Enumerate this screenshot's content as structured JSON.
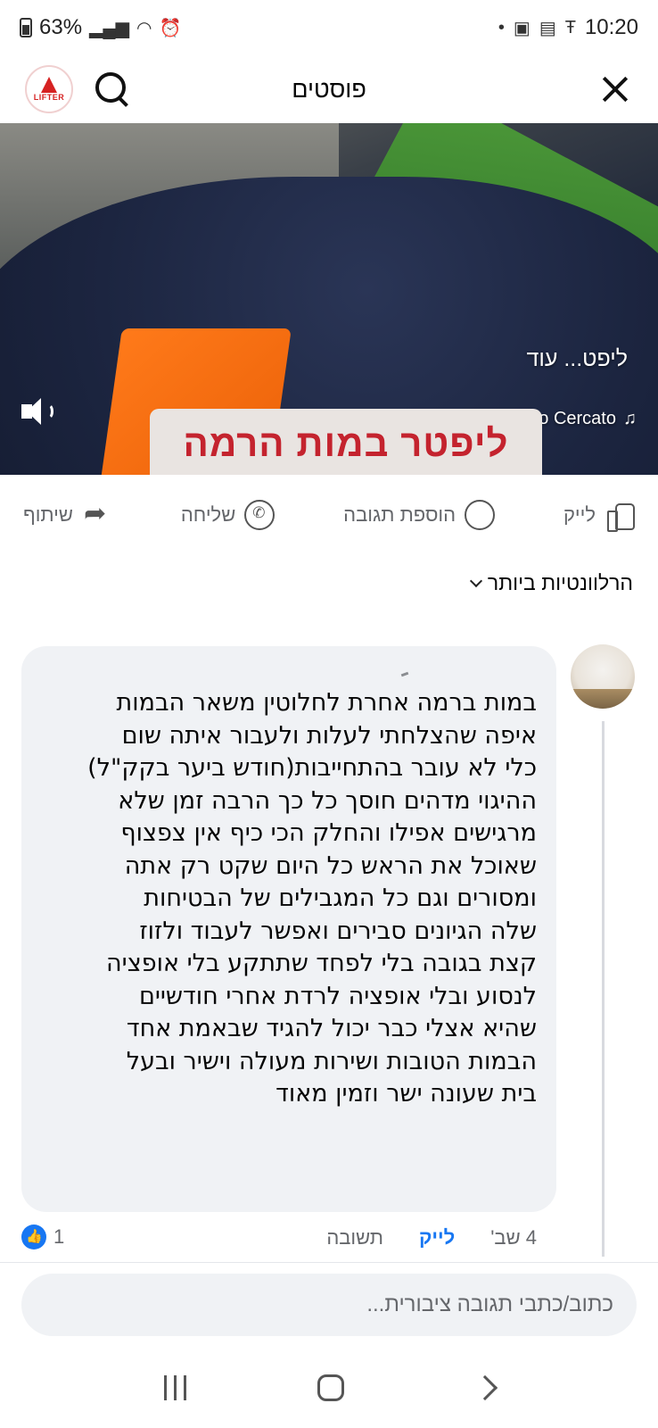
{
  "status_bar": {
    "battery": "63%",
    "time": "10:20"
  },
  "header": {
    "title": "פוסטים",
    "logo_text": "LIFTER"
  },
  "video": {
    "caption": "ליפט... עוד",
    "music": "Moments · Giulio Cercato",
    "banner": "ליפטר במות הרמה"
  },
  "actions": {
    "like": "לייק",
    "comment": "הוספת תגובה",
    "send": "שליחה",
    "share": "שיתוף"
  },
  "sort": {
    "label": "הרלוונטיות ביותר"
  },
  "comment": {
    "text": "במות ברמה אחרת לחלוטין משאר הבמות\nאיפה שהצלחתי לעלות ולעבור איתה שום\nכלי לא עובר בהתחייבות(חודש ביער בקק\"ל)\nההיגוי מדהים חוסך כל כך הרבה זמן שלא\nמרגישים אפילו והחלק הכי כיף אין צפצוף\nשאוכל את הראש כל היום שקט רק אתה\nומסורים וגם כל המגבילים של הבטיחות\nשלה הגיונים סבירים ואפשר לעבוד ולזוז\nקצת בגובה בלי לפחד שתתקע בלי אופציה\nלנסוע ובלי אופציה לרדת אחרי חודשיים\nשהיא אצלי כבר יכול להגיד שבאמת אחד\nהבמות הטובות ושירות מעולה וישיר ובעל\nבית שעונה ישר וזמין מאוד",
    "time": "4 שב'",
    "like_label": "לייק",
    "reply_label": "תשובה",
    "reaction_count": "1"
  },
  "composer": {
    "placeholder": "כתוב/כתבי תגובה ציבורית..."
  }
}
